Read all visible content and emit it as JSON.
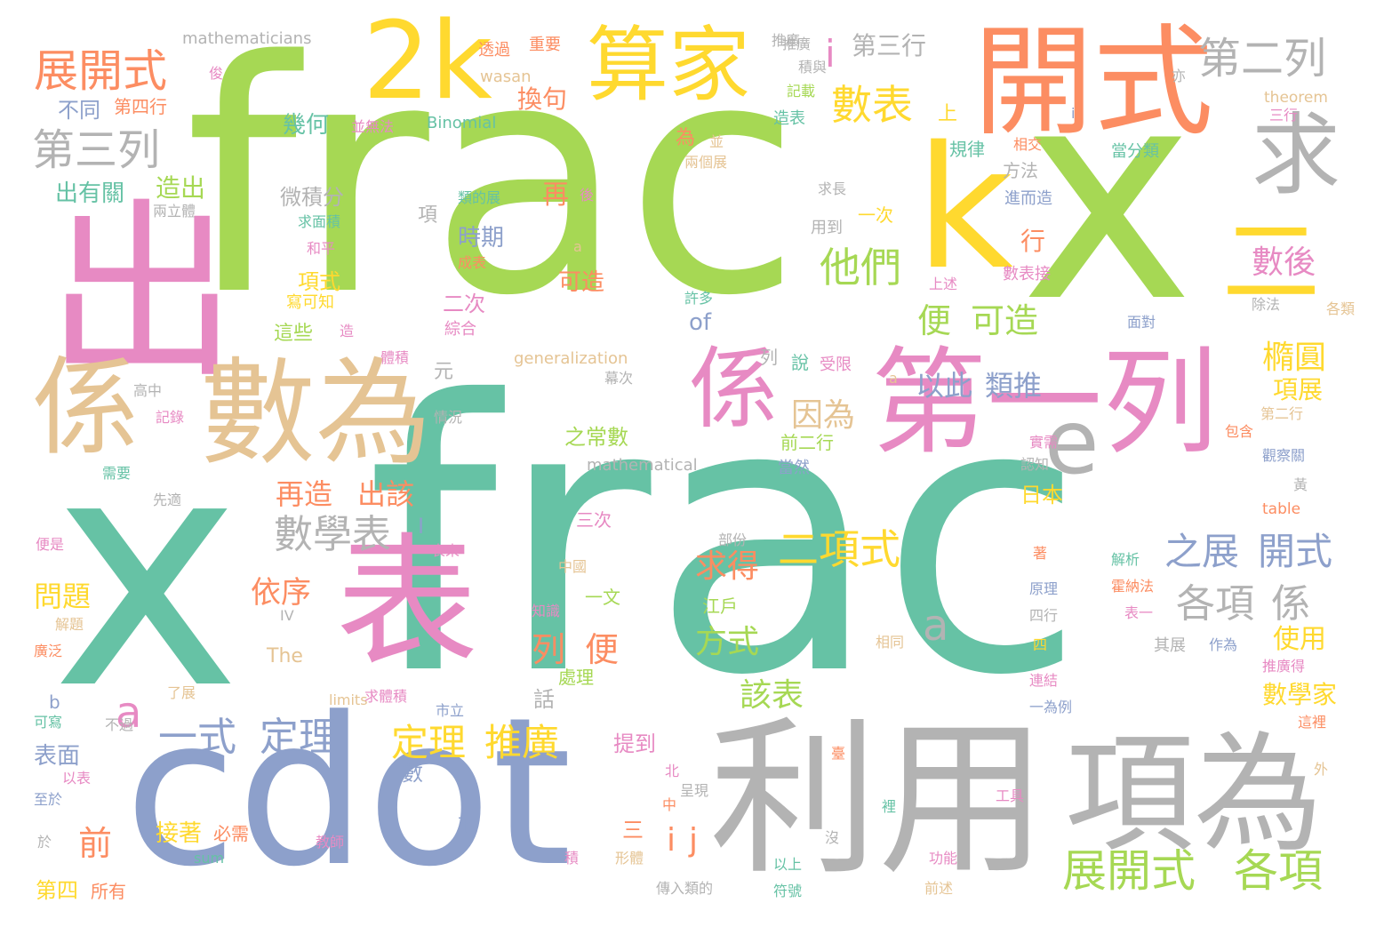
{
  "palette": {
    "green": "#a6d854",
    "teal": "#66c2a5",
    "orange": "#fc8d62",
    "blue": "#8da0cb",
    "pink": "#e78ac3",
    "yellow": "#ffd92f",
    "tan": "#e5c494",
    "gray": "#b3b3b3"
  },
  "words": [
    {
      "text": "frac"
    },
    {
      "text": "x"
    },
    {
      "text": "frac"
    },
    {
      "text": "x"
    },
    {
      "text": "cdot"
    },
    {
      "text": "利用"
    },
    {
      "text": "項為"
    },
    {
      "text": "出"
    },
    {
      "text": "係"
    },
    {
      "text": "數為"
    },
    {
      "text": "表"
    },
    {
      "text": "開式"
    },
    {
      "text": "第一列"
    },
    {
      "text": "係"
    },
    {
      "text": "算家"
    },
    {
      "text": "2k"
    },
    {
      "text": "k"
    },
    {
      "text": "求"
    },
    {
      "text": "二"
    },
    {
      "text": "e"
    },
    {
      "text": "展開式"
    },
    {
      "text": "第三列"
    },
    {
      "text": "第二列"
    },
    {
      "text": "數表"
    },
    {
      "text": "他們"
    },
    {
      "text": "展開式"
    },
    {
      "text": "各項"
    },
    {
      "text": "二項式"
    },
    {
      "text": "數學表"
    },
    {
      "text": "各項"
    },
    {
      "text": "係"
    },
    {
      "text": "之展"
    },
    {
      "text": "開式"
    },
    {
      "text": "一式"
    },
    {
      "text": "定理"
    },
    {
      "text": "定理"
    },
    {
      "text": "推廣"
    },
    {
      "text": "以此"
    },
    {
      "text": "類推"
    },
    {
      "text": "再造"
    },
    {
      "text": "出該"
    },
    {
      "text": "便"
    },
    {
      "text": "可造"
    },
    {
      "text": "因為"
    },
    {
      "text": "數後"
    },
    {
      "text": "橢圓"
    },
    {
      "text": "求得"
    },
    {
      "text": "依序"
    },
    {
      "text": "列"
    },
    {
      "text": "便"
    },
    {
      "text": "該表"
    },
    {
      "text": "方式"
    },
    {
      "text": "問題"
    },
    {
      "text": "前"
    },
    {
      "text": "a"
    },
    {
      "text": "a"
    },
    {
      "text": "i"
    },
    {
      "text": "j"
    },
    {
      "text": "i"
    },
    {
      "text": "數學家"
    },
    {
      "text": "使用"
    },
    {
      "text": "項展"
    },
    {
      "text": "第三行"
    },
    {
      "text": "換句"
    },
    {
      "text": "造出"
    },
    {
      "text": "出有關"
    },
    {
      "text": "幾何"
    },
    {
      "text": "不同"
    },
    {
      "text": "第四行"
    },
    {
      "text": "微積分"
    },
    {
      "text": "時期"
    },
    {
      "text": "可造"
    },
    {
      "text": "項式"
    },
    {
      "text": "這些"
    },
    {
      "text": "二次"
    },
    {
      "text": "of"
    },
    {
      "text": "mathematicians"
    },
    {
      "text": "Binomial"
    },
    {
      "text": "wasan"
    },
    {
      "text": "generalization"
    },
    {
      "text": "mathematical"
    },
    {
      "text": "theorem"
    },
    {
      "text": "table"
    },
    {
      "text": "The"
    },
    {
      "text": "limits"
    },
    {
      "text": "sum"
    },
    {
      "text": "第四"
    },
    {
      "text": "所有"
    },
    {
      "text": "接著"
    },
    {
      "text": "必需"
    },
    {
      "text": "表面"
    },
    {
      "text": "推廣"
    },
    {
      "text": "重要"
    },
    {
      "text": "透過"
    },
    {
      "text": "當分類"
    },
    {
      "text": "規律"
    },
    {
      "text": "相交"
    },
    {
      "text": "進而造"
    },
    {
      "text": "求長"
    },
    {
      "text": "用到"
    },
    {
      "text": "一次"
    },
    {
      "text": "數表接"
    },
    {
      "text": "面對"
    },
    {
      "text": "上述"
    },
    {
      "text": "許多"
    },
    {
      "text": "綜合"
    },
    {
      "text": "寫可知"
    },
    {
      "text": "和平"
    },
    {
      "text": "求面積"
    },
    {
      "text": "成表"
    },
    {
      "text": "類的展"
    },
    {
      "text": "兩立體"
    },
    {
      "text": "兩個展"
    },
    {
      "text": "造表"
    },
    {
      "text": "記載"
    },
    {
      "text": "體積"
    },
    {
      "text": "受限"
    },
    {
      "text": "說"
    },
    {
      "text": "幕次"
    },
    {
      "text": "元"
    },
    {
      "text": "高中"
    },
    {
      "text": "記錄"
    },
    {
      "text": "情況"
    },
    {
      "text": "前二行"
    },
    {
      "text": "當然"
    },
    {
      "text": "之常數"
    },
    {
      "text": "需要"
    },
    {
      "text": "先適"
    },
    {
      "text": "三次"
    },
    {
      "text": "日本"
    },
    {
      "text": "認知"
    },
    {
      "text": "包含"
    },
    {
      "text": "觀察關"
    },
    {
      "text": "第二行"
    },
    {
      "text": "除法"
    },
    {
      "text": "各類"
    },
    {
      "text": "便是"
    },
    {
      "text": "表來"
    },
    {
      "text": "中國"
    },
    {
      "text": "部份"
    },
    {
      "text": "解析"
    },
    {
      "text": "霍納法"
    },
    {
      "text": "原理"
    },
    {
      "text": "表一"
    },
    {
      "text": "四行"
    },
    {
      "text": "作為"
    },
    {
      "text": "其展"
    },
    {
      "text": "推廣得"
    },
    {
      "text": "這裡"
    },
    {
      "text": "相同"
    },
    {
      "text": "連結"
    },
    {
      "text": "一為例"
    },
    {
      "text": "處理"
    },
    {
      "text": "江戶"
    },
    {
      "text": "知識"
    },
    {
      "text": "一文"
    },
    {
      "text": "解題"
    },
    {
      "text": "廣泛"
    },
    {
      "text": "了展"
    },
    {
      "text": "可寫"
    },
    {
      "text": "不過"
    },
    {
      "text": "以表"
    },
    {
      "text": "至於"
    },
    {
      "text": "於"
    },
    {
      "text": "數"
    },
    {
      "text": "下"
    },
    {
      "text": "提到"
    },
    {
      "text": "北"
    },
    {
      "text": "中"
    },
    {
      "text": "呈現"
    },
    {
      "text": "三"
    },
    {
      "text": "形體"
    },
    {
      "text": "積"
    },
    {
      "text": "傳入類的"
    },
    {
      "text": "教師"
    },
    {
      "text": "以上"
    },
    {
      "text": "符號"
    },
    {
      "text": "功能"
    },
    {
      "text": "前述"
    },
    {
      "text": "工具"
    },
    {
      "text": "裡"
    },
    {
      "text": "沒"
    },
    {
      "text": "臺"
    },
    {
      "text": "求體積"
    },
    {
      "text": "市立"
    },
    {
      "text": "話"
    },
    {
      "text": "外"
    },
    {
      "text": "上"
    },
    {
      "text": "為"
    },
    {
      "text": "再"
    },
    {
      "text": "行"
    },
    {
      "text": "項"
    },
    {
      "text": "並無法"
    },
    {
      "text": "方法"
    },
    {
      "text": "並"
    },
    {
      "text": "後"
    },
    {
      "text": "亦"
    },
    {
      "text": "三行"
    },
    {
      "text": "積與"
    },
    {
      "text": "推廣"
    },
    {
      "text": "俊"
    },
    {
      "text": "IV"
    },
    {
      "text": "b"
    },
    {
      "text": "I"
    },
    {
      "text": "著"
    },
    {
      "text": "實需"
    },
    {
      "text": "黃"
    },
    {
      "text": "四"
    },
    {
      "text": "造"
    },
    {
      "text": "列"
    },
    {
      "text": "a"
    },
    {
      "text": "a"
    },
    {
      "text": "i"
    }
  ]
}
